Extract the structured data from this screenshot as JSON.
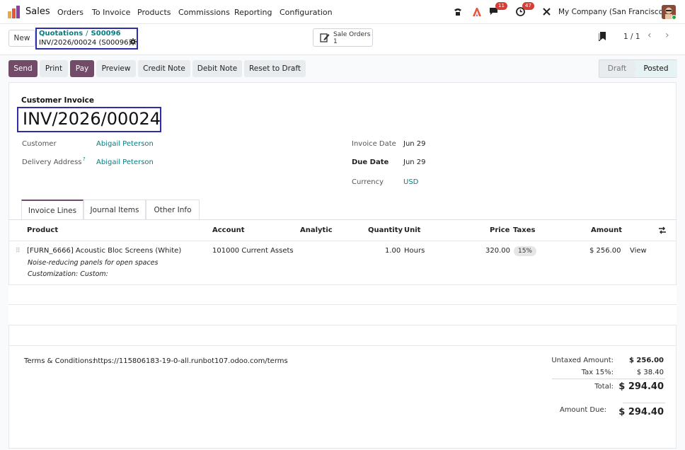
{
  "navbar": {
    "app_name": "Sales",
    "menu": [
      "Orders",
      "To Invoice",
      "Products",
      "Commissions",
      "Reporting",
      "Configuration"
    ],
    "messages_count": "11",
    "activities_count": "47",
    "company": "My Company (San Francisco)"
  },
  "control": {
    "new_label": "New",
    "breadcrumb_parent": "Quotations",
    "breadcrumb_order": "S00096",
    "breadcrumb_current": "INV/2026/00024 (S00096)",
    "smart_button_label": "Sale Orders",
    "smart_button_count": "1",
    "pager": "1 / 1"
  },
  "actions": {
    "send": "Send",
    "print": "Print",
    "pay": "Pay",
    "preview": "Preview",
    "credit_note": "Credit Note",
    "debit_note": "Debit Note",
    "reset_to_draft": "Reset to Draft"
  },
  "status": {
    "draft": "Draft",
    "posted": "Posted"
  },
  "invoice": {
    "type_label": "Customer Invoice",
    "number": "INV/2026/00024",
    "customer_label": "Customer",
    "customer": "Abigail Peterson",
    "delivery_label": "Delivery Address",
    "delivery_help": "?",
    "delivery": "Abigail Peterson",
    "invoice_date_label": "Invoice Date",
    "invoice_date": "Jun 29",
    "due_date_label": "Due Date",
    "due_date": "Jun 29",
    "currency_label": "Currency",
    "currency": "USD"
  },
  "tabs": [
    "Invoice Lines",
    "Journal Items",
    "Other Info"
  ],
  "lines": {
    "headers": {
      "product": "Product",
      "account": "Account",
      "analytic": "Analytic",
      "quantity": "Quantity",
      "unit": "Unit",
      "price": "Price",
      "taxes": "Taxes",
      "amount": "Amount"
    },
    "rows": [
      {
        "product": "[FURN_6666] Acoustic Bloc Screens (White)",
        "desc1": "Noise-reducing panels for open spaces",
        "desc2": "Customization: Custom:",
        "account": "101000 Current Assets",
        "quantity": "1.00",
        "unit": "Hours",
        "price": "320.00",
        "tax": "15%",
        "amount": "$ 256.00",
        "view": "View"
      }
    ]
  },
  "terms": {
    "label": "Terms & Conditions:",
    "url": "https://115806183-19-0-all.runbot107.odoo.com/terms"
  },
  "totals": {
    "untaxed_label": "Untaxed Amount:",
    "untaxed": "$ 256.00",
    "tax_label": "Tax 15%:",
    "tax": "$ 38.40",
    "total_label": "Total:",
    "total": "$ 294.40",
    "due_label": "Amount Due:",
    "due": "$ 294.40"
  },
  "colors": {
    "brand": "#714b67",
    "link": "#017e84",
    "highlight_box": "#2e2ea6",
    "badge": "#d23f3a"
  }
}
